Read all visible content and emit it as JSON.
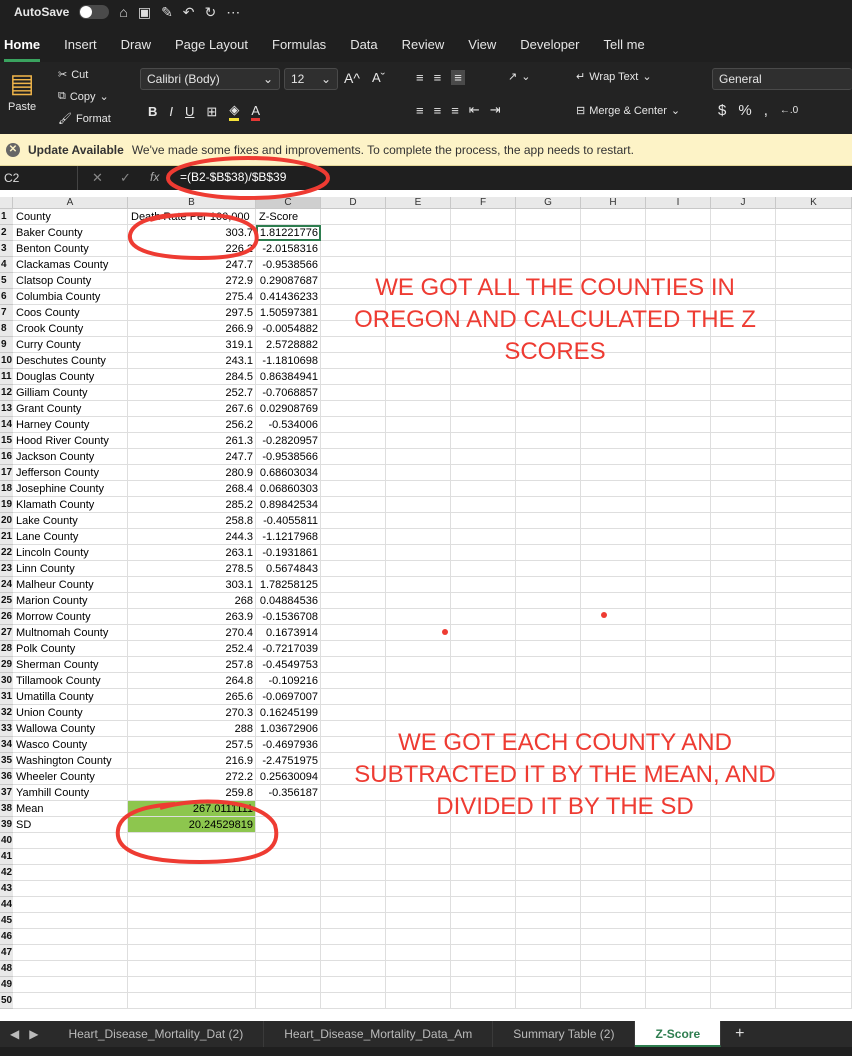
{
  "titlebar": {
    "autosave": "AutoSave"
  },
  "tabs": [
    "Home",
    "Insert",
    "Draw",
    "Page Layout",
    "Formulas",
    "Data",
    "Review",
    "View",
    "Developer",
    "Tell me"
  ],
  "ribbon": {
    "paste": "Paste",
    "cut": "Cut",
    "copy": "Copy",
    "format": "Format",
    "font_name": "Calibri (Body)",
    "font_size": "12",
    "wrap_text": "Wrap Text",
    "merge_center": "Merge & Center",
    "number_format": "General"
  },
  "update_bar": {
    "title": "Update Available",
    "message": "We've made some fixes and improvements. To complete the process, the app needs to restart."
  },
  "formula_bar": {
    "name_box": "C2",
    "formula": "=(B2-$B$38)/$B$39"
  },
  "columns": [
    "A",
    "B",
    "C",
    "D",
    "E",
    "F",
    "G",
    "H",
    "I",
    "J",
    "K"
  ],
  "headers": {
    "a": "County",
    "b": "Death Rate Per 100,000",
    "c": "Z-Score"
  },
  "rows": [
    {
      "county": "Baker County",
      "rate": "303.7",
      "z": "1.81221776"
    },
    {
      "county": "Benton County",
      "rate": "226.2",
      "z": "-2.0158316"
    },
    {
      "county": "Clackamas County",
      "rate": "247.7",
      "z": "-0.9538566"
    },
    {
      "county": "Clatsop County",
      "rate": "272.9",
      "z": "0.29087687"
    },
    {
      "county": "Columbia County",
      "rate": "275.4",
      "z": "0.41436233"
    },
    {
      "county": "Coos County",
      "rate": "297.5",
      "z": "1.50597381"
    },
    {
      "county": "Crook County",
      "rate": "266.9",
      "z": "-0.0054882"
    },
    {
      "county": "Curry County",
      "rate": "319.1",
      "z": "2.5728882"
    },
    {
      "county": "Deschutes County",
      "rate": "243.1",
      "z": "-1.1810698"
    },
    {
      "county": "Douglas County",
      "rate": "284.5",
      "z": "0.86384941"
    },
    {
      "county": "Gilliam County",
      "rate": "252.7",
      "z": "-0.7068857"
    },
    {
      "county": "Grant County",
      "rate": "267.6",
      "z": "0.02908769"
    },
    {
      "county": "Harney County",
      "rate": "256.2",
      "z": "-0.534006"
    },
    {
      "county": "Hood River County",
      "rate": "261.3",
      "z": "-0.2820957"
    },
    {
      "county": "Jackson County",
      "rate": "247.7",
      "z": "-0.9538566"
    },
    {
      "county": "Jefferson County",
      "rate": "280.9",
      "z": "0.68603034"
    },
    {
      "county": "Josephine County",
      "rate": "268.4",
      "z": "0.06860303"
    },
    {
      "county": "Klamath County",
      "rate": "285.2",
      "z": "0.89842534"
    },
    {
      "county": "Lake County",
      "rate": "258.8",
      "z": "-0.4055811"
    },
    {
      "county": "Lane County",
      "rate": "244.3",
      "z": "-1.1217968"
    },
    {
      "county": "Lincoln County",
      "rate": "263.1",
      "z": "-0.1931861"
    },
    {
      "county": "Linn County",
      "rate": "278.5",
      "z": "0.5674843"
    },
    {
      "county": "Malheur County",
      "rate": "303.1",
      "z": "1.78258125"
    },
    {
      "county": "Marion County",
      "rate": "268",
      "z": "0.04884536"
    },
    {
      "county": "Morrow County",
      "rate": "263.9",
      "z": "-0.1536708"
    },
    {
      "county": "Multnomah County",
      "rate": "270.4",
      "z": "0.1673914"
    },
    {
      "county": "Polk County",
      "rate": "252.4",
      "z": "-0.7217039"
    },
    {
      "county": "Sherman County",
      "rate": "257.8",
      "z": "-0.4549753"
    },
    {
      "county": "Tillamook County",
      "rate": "264.8",
      "z": "-0.109216"
    },
    {
      "county": "Umatilla County",
      "rate": "265.6",
      "z": "-0.0697007"
    },
    {
      "county": "Union County",
      "rate": "270.3",
      "z": "0.16245199"
    },
    {
      "county": "Wallowa County",
      "rate": "288",
      "z": "1.03672906"
    },
    {
      "county": "Wasco County",
      "rate": "257.5",
      "z": "-0.4697936"
    },
    {
      "county": "Washington County",
      "rate": "216.9",
      "z": "-2.4751975"
    },
    {
      "county": "Wheeler County",
      "rate": "272.2",
      "z": "0.25630094"
    },
    {
      "county": "Yamhill County",
      "rate": "259.8",
      "z": "-0.356187"
    }
  ],
  "summary": [
    {
      "label": "Mean",
      "value": "267.0111111"
    },
    {
      "label": "SD",
      "value": "20.24529819"
    }
  ],
  "annotations": {
    "top": "WE GOT ALL THE COUNTIES IN OREGON AND CALCULATED THE Z SCORES",
    "bottom": "WE GOT EACH COUNTY AND SUBTRACTED IT BY THE MEAN, AND DIVIDED IT BY THE SD"
  },
  "sheet_tabs": [
    "Heart_Disease_Mortality_Dat (2)",
    "Heart_Disease_Mortality_Data_Am",
    "Summary Table (2)",
    "Z-Score"
  ],
  "colors": {
    "annotation": "#ee3b32",
    "highlight": "#8dc64e",
    "accent": "#2e7d4f"
  }
}
